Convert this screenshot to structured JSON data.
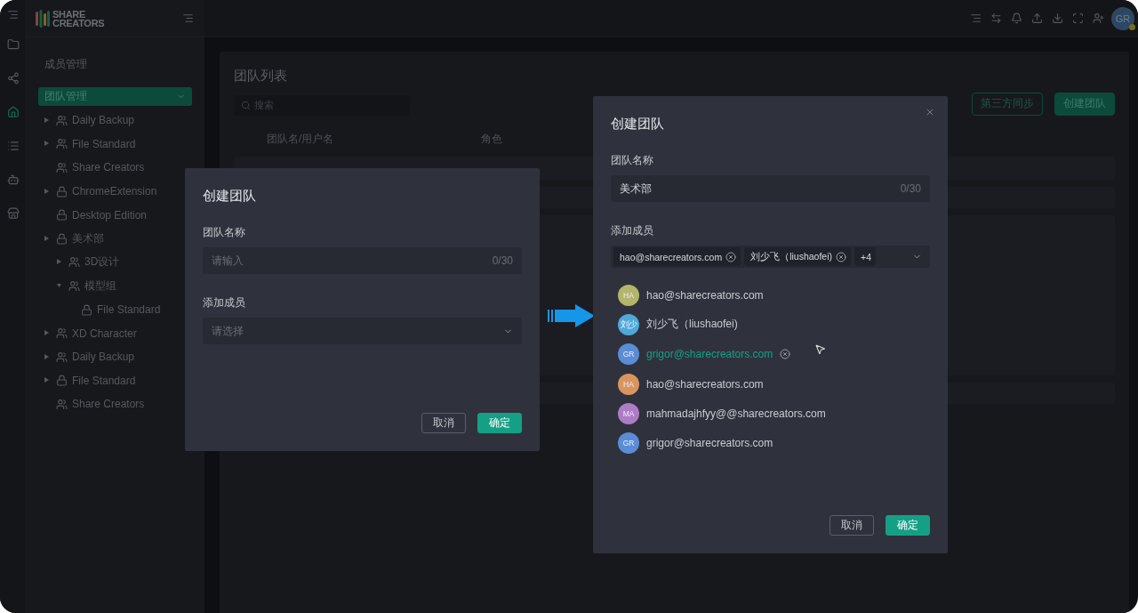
{
  "logo": {
    "line1": "SHARE",
    "line2": "CREATORS"
  },
  "rail": {
    "items": [
      {
        "kind": "folder",
        "selected": false
      },
      {
        "kind": "share",
        "selected": false
      },
      {
        "kind": "home",
        "selected": true
      },
      {
        "kind": "list",
        "selected": false
      },
      {
        "kind": "bot",
        "selected": false
      },
      {
        "kind": "store",
        "selected": false
      }
    ]
  },
  "topbar": {
    "avatar": "GR"
  },
  "sidebar": {
    "section": "成员管理",
    "group": {
      "label": "团队管理",
      "expanded": true
    },
    "items": [
      {
        "label": "Daily Backup",
        "kind": "team",
        "expanded": false
      },
      {
        "label": "File Standard",
        "kind": "team",
        "expanded": false
      },
      {
        "label": "Share Creators",
        "kind": "team"
      },
      {
        "label": "ChromeExtension",
        "kind": "private",
        "expanded": false
      },
      {
        "label": "Desktop Edition",
        "kind": "private"
      },
      {
        "label": "美术部",
        "kind": "private",
        "expanded": false,
        "children": [
          {
            "label": "3D设计",
            "kind": "team",
            "expanded": false
          },
          {
            "label": "模型组",
            "kind": "team",
            "expanded": true,
            "children": [
              {
                "label": "File Standard",
                "kind": "private"
              }
            ]
          }
        ]
      },
      {
        "label": "XD Character",
        "kind": "team",
        "expanded": false
      },
      {
        "label": "Daily Backup",
        "kind": "team",
        "expanded": false
      },
      {
        "label": "File Standard",
        "kind": "private",
        "expanded": false
      },
      {
        "label": "Share Creators",
        "kind": "team"
      }
    ]
  },
  "main": {
    "title": "团队列表",
    "search": {
      "placeholder": "搜索"
    },
    "buttons": [
      {
        "label": "第三方同步",
        "kind": "outline"
      },
      {
        "label": "创建团队",
        "kind": "primary"
      }
    ],
    "columns": [
      "团队名/用户名",
      "角色"
    ]
  },
  "dialog_empty": {
    "title": "创建团队",
    "name_label": "团队名称",
    "name_placeholder": "请输入",
    "counter": "0/30",
    "members_label": "添加成员",
    "members_placeholder": "请选择",
    "buttons": [
      {
        "label": "取消",
        "kind": "cancel"
      },
      {
        "label": "确定",
        "kind": "primary"
      }
    ]
  },
  "dialog_filled": {
    "title": "创建团队",
    "name_label": "团队名称",
    "name_value": "美术部",
    "counter": "0/30",
    "members_label": "添加成员",
    "tags": [
      "hao@sharecreators.com",
      "刘少飞（liushaofei)"
    ],
    "more": "+4",
    "options": [
      {
        "initials": "HA",
        "name": "hao@sharecreators.com",
        "color": "#b3b56a",
        "selected": false
      },
      {
        "initials": "刘少",
        "name": "刘少飞（liushaofei)",
        "color": "#4ea9d9",
        "selected": false
      },
      {
        "initials": "GR",
        "name": "grigor@sharecreators.com",
        "color": "#5a8dd6",
        "selected": true
      },
      {
        "initials": "HA",
        "name": "hao@sharecreators.com",
        "color": "#d9955f",
        "selected": false
      },
      {
        "initials": "MA",
        "name": "mahmadajhfyy@@sharecreators.com",
        "color": "#ad7cc4",
        "selected": false
      },
      {
        "initials": "GR",
        "name": "grigor@sharecreators.com",
        "color": "#5a8dd6",
        "selected": false
      }
    ],
    "buttons": [
      {
        "label": "取消",
        "kind": "cancel"
      },
      {
        "label": "确定",
        "kind": "primary"
      }
    ]
  }
}
